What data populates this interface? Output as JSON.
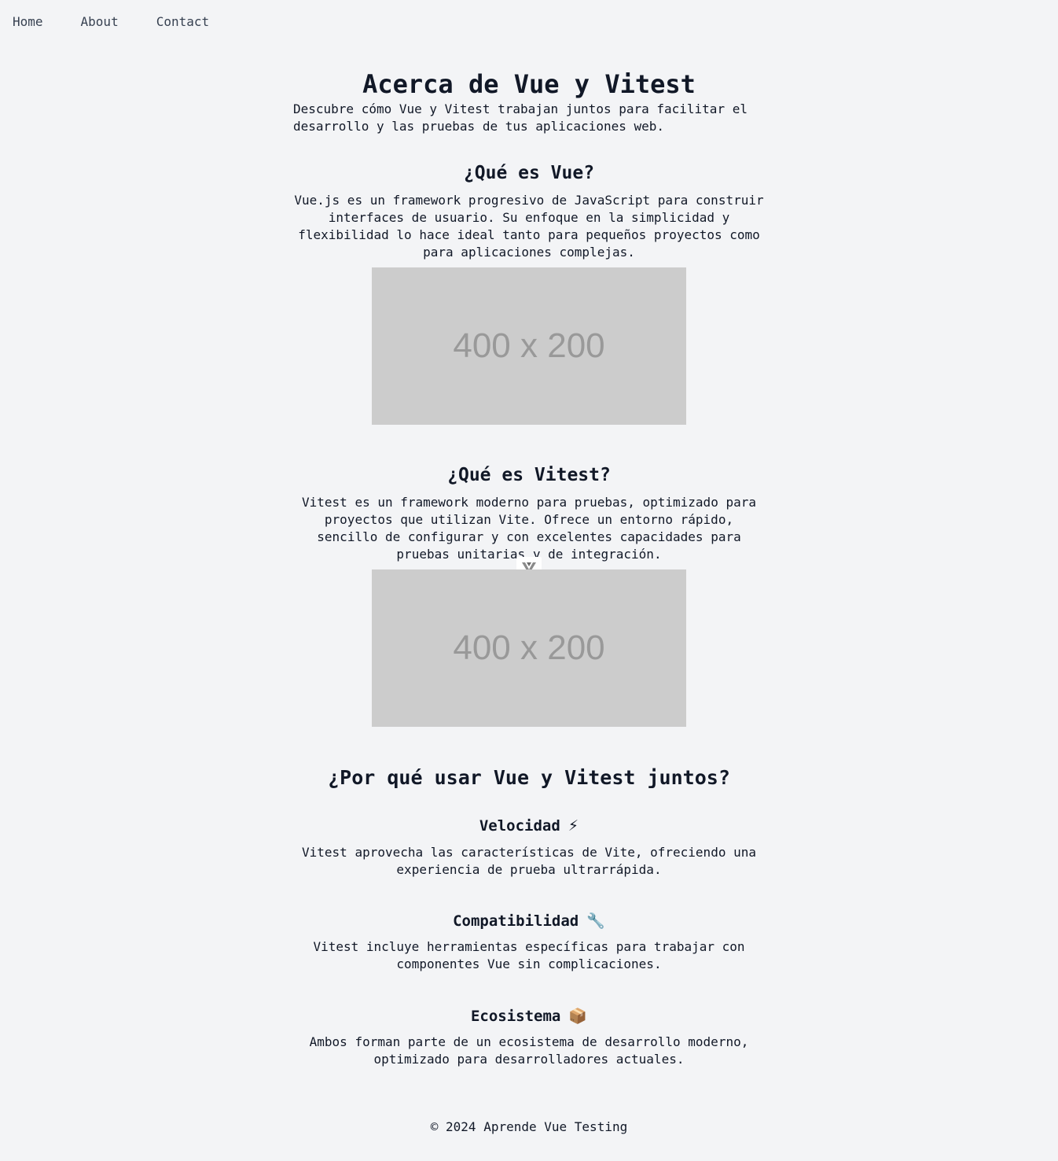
{
  "nav": {
    "items": [
      "Home",
      "About",
      "Contact"
    ]
  },
  "hero": {
    "title": "Acerca de Vue y Vitest",
    "text": "Descubre cómo Vue y Vitest trabajan juntos para facilitar el desarrollo y las pruebas de tus aplicaciones web."
  },
  "sections": {
    "vue": {
      "title": "¿Qué es Vue?",
      "text": "Vue.js es un framework progresivo de JavaScript para construir interfaces de usuario. Su enfoque en la simplicidad y flexibilidad lo hace ideal tanto para pequeños proyectos como para aplicaciones complejas.",
      "image_label": "400 x 200"
    },
    "vitest": {
      "title": "¿Qué es Vitest?",
      "text": "Vitest es un framework moderno para pruebas, optimizado para proyectos que utilizan Vite. Ofrece un entorno rápido, sencillo de configurar y con excelentes capacidades para pruebas unitarias y de integración.",
      "image_label": "400 x 200"
    }
  },
  "why": {
    "title": "¿Por qué usar Vue y Vitest juntos?",
    "features": [
      {
        "title": "Velocidad",
        "emoji": "⚡",
        "text": "Vitest aprovecha las características de Vite, ofreciendo una experiencia de prueba ultrarrápida."
      },
      {
        "title": "Compatibilidad",
        "emoji": "🔧",
        "text": "Vitest incluye herramientas específicas para trabajar con componentes Vue sin complicaciones."
      },
      {
        "title": "Ecosistema",
        "emoji": "📦",
        "text": "Ambos forman parte de un ecosistema de desarrollo moderno, optimizado para desarrolladores actuales."
      }
    ]
  },
  "footer": {
    "text": "© 2024 Aprende Vue Testing"
  },
  "icons": {
    "vue_badge": "vue-logo-icon"
  },
  "colors": {
    "background": "#f3f4f6",
    "text": "#111827",
    "nav": "#374151",
    "placeholder_bg": "#cccccc",
    "placeholder_text": "#999999"
  }
}
